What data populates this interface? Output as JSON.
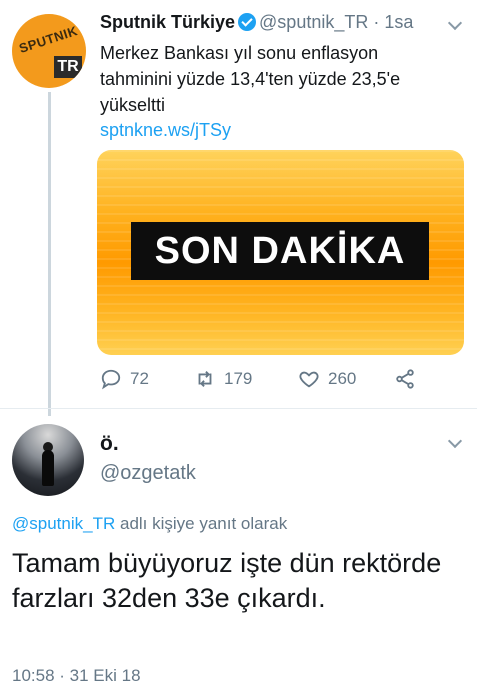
{
  "tweet": {
    "author_name": "Sputnik Türkiye",
    "author_handle": "@sputnik_TR",
    "separator": "·",
    "time": "1sa",
    "avatar_text": "SPUTNIK",
    "avatar_badge": "TR",
    "text": "Merkez Bankası yıl sonu enflasyon tahminini yüzde 13,4'ten yüzde 23,5'e yükseltti",
    "link": "sptnkne.ws/jTSy",
    "card_banner": "SON DAKİKA",
    "reply_count": "72",
    "retweet_count": "179",
    "like_count": "260"
  },
  "reply": {
    "author_name": "ö.",
    "author_handle": "@ozgetatk",
    "replying_to_mention": "@sputnik_TR",
    "replying_to_suffix": "adlı kişiye yanıt olarak",
    "text": "Tamam büyüyoruz işte dün rektörde farzları 32den 33e çıkardı.",
    "timestamp": "10:58 · 31 Eki 18"
  },
  "colors": {
    "accent": "#1da1f2",
    "muted": "#657786",
    "card_orange": "#ff9a00"
  }
}
